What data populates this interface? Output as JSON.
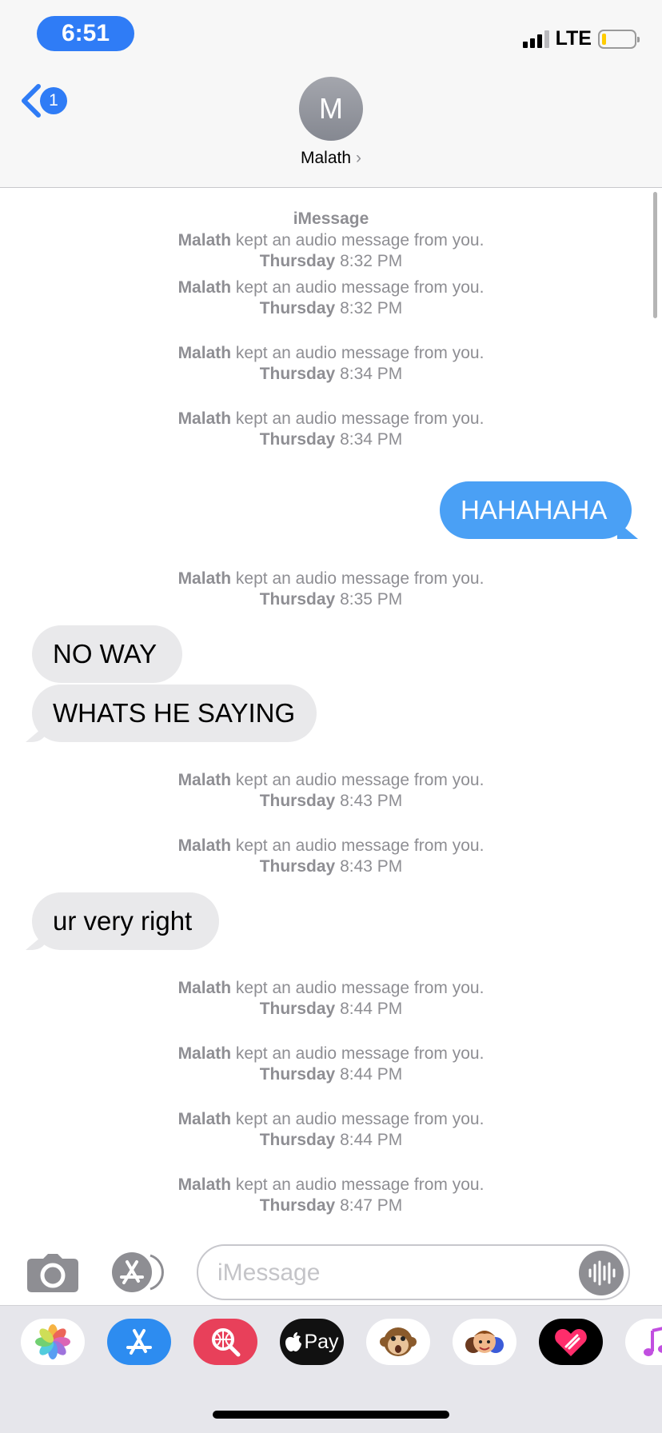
{
  "status_bar": {
    "time": "6:51",
    "network": "LTE"
  },
  "nav": {
    "back_badge": "1",
    "contact_initial": "M",
    "contact_name": "Malath",
    "contact_chevron": "›"
  },
  "transcript": {
    "service_label": "iMessage",
    "events": [
      {
        "type": "notice",
        "name": "Malath",
        "text": "kept an audio message from you.",
        "day": "Thursday",
        "time": "8:32 PM"
      },
      {
        "type": "notice",
        "name": "Malath",
        "text": "kept an audio message from you.",
        "day": "Thursday",
        "time": "8:32 PM"
      },
      {
        "type": "notice",
        "name": "Malath",
        "text": "kept an audio message from you.",
        "day": "Thursday",
        "time": "8:34 PM"
      },
      {
        "type": "notice",
        "name": "Malath",
        "text": "kept an audio message from you.",
        "day": "Thursday",
        "time": "8:34 PM"
      },
      {
        "type": "sent",
        "text": "HAHAHAHA"
      },
      {
        "type": "notice",
        "name": "Malath",
        "text": "kept an audio message from you.",
        "day": "Thursday",
        "time": "8:35 PM"
      },
      {
        "type": "received",
        "text": "NO WAY"
      },
      {
        "type": "received",
        "text": "WHATS HE SAYING"
      },
      {
        "type": "notice",
        "name": "Malath",
        "text": "kept an audio message from you.",
        "day": "Thursday",
        "time": "8:43 PM"
      },
      {
        "type": "notice",
        "name": "Malath",
        "text": "kept an audio message from you.",
        "day": "Thursday",
        "time": "8:43 PM"
      },
      {
        "type": "received",
        "text": "ur very right"
      },
      {
        "type": "notice",
        "name": "Malath",
        "text": "kept an audio message from you.",
        "day": "Thursday",
        "time": "8:44 PM"
      },
      {
        "type": "notice",
        "name": "Malath",
        "text": "kept an audio message from you.",
        "day": "Thursday",
        "time": "8:44 PM"
      },
      {
        "type": "notice",
        "name": "Malath",
        "text": "kept an audio message from you.",
        "day": "Thursday",
        "time": "8:44 PM"
      },
      {
        "type": "notice",
        "name": "Malath",
        "text": "kept an audio message from you.",
        "day": "Thursday",
        "time": "8:47 PM"
      }
    ]
  },
  "composer": {
    "placeholder": "iMessage"
  },
  "app_drawer": {
    "apps": [
      {
        "icon": "photos-icon"
      },
      {
        "icon": "app-store-icon"
      },
      {
        "icon": "image-search-icon"
      },
      {
        "icon": "apple-pay-icon",
        "label": "Pay"
      },
      {
        "icon": "animoji-monkey-icon"
      },
      {
        "icon": "memoji-icon"
      },
      {
        "icon": "digital-touch-icon"
      },
      {
        "icon": "music-icon"
      }
    ]
  },
  "colors": {
    "accent": "#2f7cf6",
    "sent_bubble": "#4aa0f5",
    "received_bubble": "#e9e9eb",
    "secondary_text": "#8e8e93"
  }
}
